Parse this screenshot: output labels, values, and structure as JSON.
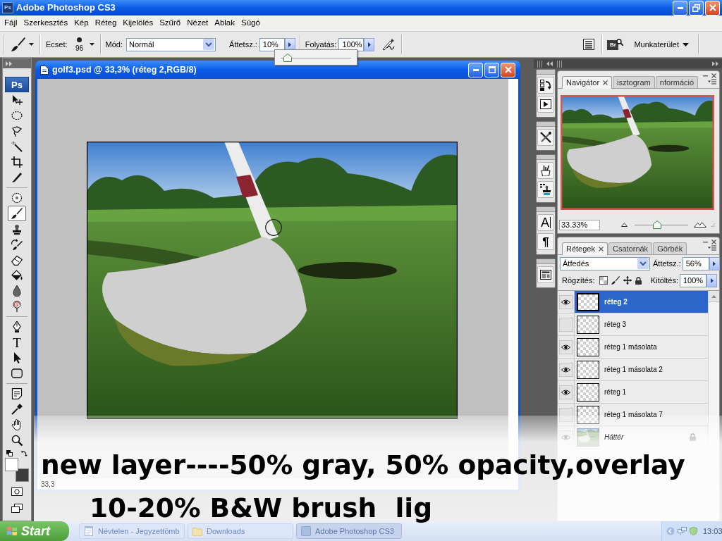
{
  "window": {
    "app_icon": "Ps",
    "title": "Adobe Photoshop CS3"
  },
  "menu": [
    "Fájl",
    "Szerkesztés",
    "Kép",
    "Réteg",
    "Kijelölés",
    "Szűrő",
    "Nézet",
    "Ablak",
    "Súgó"
  ],
  "options_bar": {
    "brush_label": "Ecset:",
    "brush_size": "96",
    "mode_label": "Mód:",
    "mode": "Normál",
    "opacity_label": "Áttetsz.:",
    "opacity": "10%",
    "opacity_popup": {
      "level": 0.1
    },
    "flow_label": "Folyatás:",
    "flow": "100%",
    "bridge_label": "Br",
    "workspace_menu": "Munkaterület"
  },
  "toolbox": {
    "logo": "Ps",
    "tools": [
      [
        {
          "kind": "move",
          "selected": false
        },
        {
          "kind": "marquee",
          "selected": false
        },
        {
          "kind": "lasso",
          "selected": false
        },
        {
          "kind": "wand",
          "selected": false
        },
        {
          "kind": "crop",
          "selected": false
        },
        {
          "kind": "slice",
          "selected": false
        }
      ],
      [
        {
          "kind": "heal",
          "selected": false
        },
        {
          "kind": "brush",
          "selected": true
        },
        {
          "kind": "stamp",
          "selected": false
        },
        {
          "kind": "history",
          "selected": false
        },
        {
          "kind": "eraser",
          "selected": false
        },
        {
          "kind": "bucket",
          "selected": false
        },
        {
          "kind": "blur",
          "selected": false
        },
        {
          "kind": "dodge",
          "selected": false
        }
      ],
      [
        {
          "kind": "pen",
          "selected": false
        },
        {
          "kind": "type",
          "glyph": "T",
          "selected": false
        },
        {
          "kind": "select",
          "selected": false
        },
        {
          "kind": "shape",
          "selected": false
        }
      ],
      [
        {
          "kind": "notes",
          "selected": false
        },
        {
          "kind": "eyedropper",
          "selected": false
        },
        {
          "kind": "hand",
          "selected": false
        },
        {
          "kind": "zoom",
          "selected": false
        }
      ]
    ]
  },
  "document": {
    "title": "golf3.psd @ 33,3% (réteg 2,RGB/8)",
    "status_zoom": "33,3"
  },
  "dock_icons": [
    [
      {
        "kind": "history"
      },
      {
        "kind": "actions"
      }
    ],
    [
      {
        "kind": "presets"
      }
    ],
    [
      {
        "kind": "brushes"
      },
      {
        "kind": "clone"
      }
    ],
    [
      {
        "kind": "character",
        "glyph": "A"
      },
      {
        "kind": "paragraph",
        "glyph": "¶"
      }
    ],
    [
      {
        "kind": "comps"
      }
    ]
  ],
  "navigator": {
    "tabs": [
      {
        "label": "Navigátor",
        "selected": true
      },
      {
        "label": "isztogram",
        "selected": false
      },
      {
        "label": "nformáció",
        "selected": false
      }
    ],
    "zoom": "33.33%",
    "zoom_slider": {
      "level": 0.42
    }
  },
  "layers_panel": {
    "tabs": [
      {
        "label": "Rétegek",
        "selected": true
      },
      {
        "label": "Csatornák",
        "selected": false
      },
      {
        "label": "Görbék",
        "selected": false
      }
    ],
    "blend_mode": "Átfedés",
    "opacity_label": "Áttetsz.:",
    "opacity": "56%",
    "lock_label": "Rögzítés:",
    "fill_label": "Kitöltés:",
    "fill": "100%",
    "layers": [
      {
        "name": "réteg 2",
        "kind": "layer",
        "visible": true,
        "selected": true,
        "locked": false
      },
      {
        "name": "réteg 3",
        "kind": "layer",
        "visible": false,
        "selected": false,
        "locked": false
      },
      {
        "name": "réteg 1 másolata",
        "kind": "layer",
        "visible": true,
        "selected": false,
        "locked": false
      },
      {
        "name": "réteg 1 másolata 2",
        "kind": "layer",
        "visible": true,
        "selected": false,
        "locked": false
      },
      {
        "name": "réteg 1",
        "kind": "layer",
        "visible": true,
        "selected": false,
        "locked": false
      },
      {
        "name": "réteg 1 másolata 7",
        "kind": "layer",
        "visible": false,
        "selected": false,
        "locked": false
      },
      {
        "name": "Háttér",
        "kind": "background",
        "visible": true,
        "selected": false,
        "locked": true
      }
    ]
  },
  "caption": [
    "new layer----50% gray, 50% opacity,overlay",
    "10-20% B&W brush  lig"
  ],
  "taskbar": {
    "start": "Start",
    "items": [
      {
        "label": "Névtelen - Jegyzettömb",
        "kind": "notepad",
        "selected": false
      },
      {
        "label": "Downloads",
        "kind": "folder",
        "selected": false
      },
      {
        "label": "Adobe Photoshop CS3",
        "kind": "app",
        "selected": true
      }
    ],
    "clock": "13:03"
  }
}
